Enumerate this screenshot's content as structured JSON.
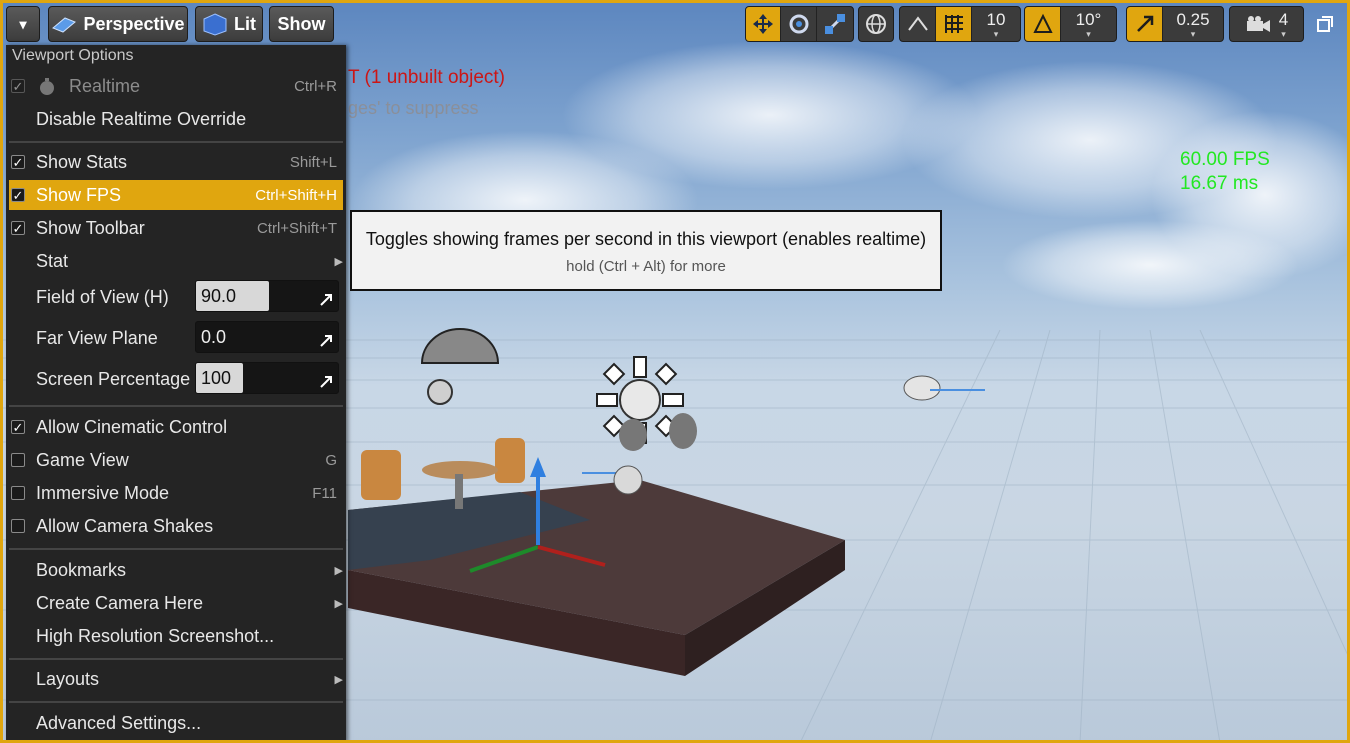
{
  "toolbar": {
    "menu_dropdown": "▾",
    "perspective_label": "Perspective",
    "lit_label": "Lit",
    "show_label": "Show",
    "grid_snap_value": "10",
    "rotation_snap_value": "10°",
    "scale_snap_value": "0.25",
    "camera_speed_value": "4"
  },
  "viewport": {
    "warning_text": "T (1 unbuilt object)",
    "warning_subtext": "ges' to suppress",
    "fps_text": "60.00 FPS",
    "ms_text": "16.67 ms",
    "accent_color": "#e0a60f"
  },
  "menu": {
    "section_title": "Viewport Options",
    "realtime": {
      "label": "Realtime",
      "shortcut": "Ctrl+R"
    },
    "disable_realtime_override": {
      "label": "Disable Realtime Override"
    },
    "show_stats": {
      "label": "Show Stats",
      "shortcut": "Shift+L"
    },
    "show_fps": {
      "label": "Show FPS",
      "shortcut": "Ctrl+Shift+H"
    },
    "show_toolbar": {
      "label": "Show Toolbar",
      "shortcut": "Ctrl+Shift+T"
    },
    "stat": {
      "label": "Stat"
    },
    "field_of_view": {
      "label": "Field of View (H)",
      "value": "90.0"
    },
    "far_view_plane": {
      "label": "Far View Plane",
      "value": "0.0"
    },
    "screen_percentage": {
      "label": "Screen Percentage",
      "value": "100"
    },
    "allow_cinematic_control": {
      "label": "Allow Cinematic Control"
    },
    "game_view": {
      "label": "Game View",
      "shortcut": "G"
    },
    "immersive_mode": {
      "label": "Immersive Mode",
      "shortcut": "F11"
    },
    "allow_camera_shakes": {
      "label": "Allow Camera Shakes"
    },
    "bookmarks": {
      "label": "Bookmarks"
    },
    "create_camera_here": {
      "label": "Create Camera Here"
    },
    "high_res_screenshot": {
      "label": "High Resolution Screenshot..."
    },
    "layouts": {
      "label": "Layouts"
    },
    "advanced_settings": {
      "label": "Advanced Settings..."
    },
    "check_glyph": "✓",
    "submenu_glyph": "▶"
  },
  "tooltip": {
    "main": "Toggles showing frames per second in this viewport (enables realtime)",
    "hint": "hold (Ctrl + Alt) for more"
  }
}
